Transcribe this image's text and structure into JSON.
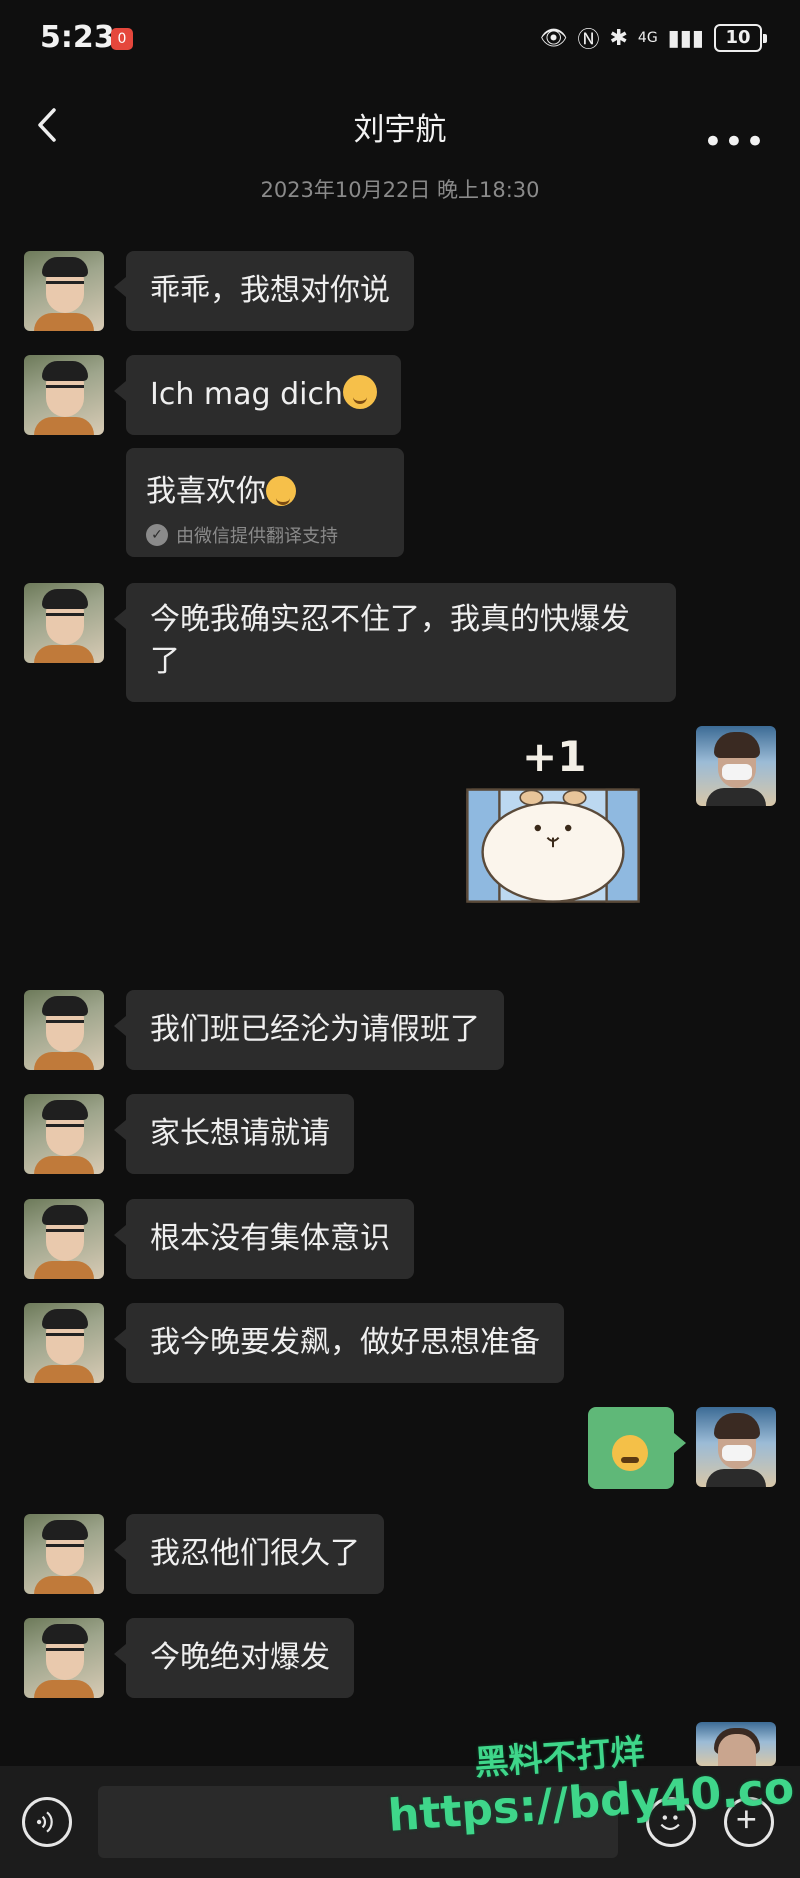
{
  "status_bar": {
    "time": "5:23",
    "notification_badge": "0",
    "network": "4G",
    "battery": "10"
  },
  "header": {
    "title": "刘宇航"
  },
  "chat": {
    "timestamp": "2023年10月22日 晚上18:30",
    "messages": [
      {
        "from": "other",
        "text": "乖乖，我想对你说"
      },
      {
        "from": "other",
        "text": "Ich mag dich"
      },
      {
        "from": "other",
        "translation": "我喜欢你",
        "note": "由微信提供翻译支持"
      },
      {
        "from": "other",
        "text": "今晚我确实忍不住了，我真的快爆发了"
      },
      {
        "from": "me",
        "sticker": "+1"
      },
      {
        "from": "other",
        "text": "我们班已经沦为请假班了"
      },
      {
        "from": "other",
        "text": "家长想请就请"
      },
      {
        "from": "other",
        "text": "根本没有集体意识"
      },
      {
        "from": "other",
        "text": "我今晚要发飙，做好思想准备"
      },
      {
        "from": "me",
        "emoji": "angry-face"
      },
      {
        "from": "other",
        "text": "我忍他们很久了"
      },
      {
        "from": "other",
        "text": "今晚绝对爆发"
      }
    ]
  },
  "watermark": {
    "line1": "黑料不打烊",
    "line2": "https://bdy40.co"
  },
  "colors": {
    "background": "#0f0f0f",
    "bubble_other": "#2c2c2c",
    "bubble_me": "#5fb878",
    "watermark": "#3fd68a"
  }
}
